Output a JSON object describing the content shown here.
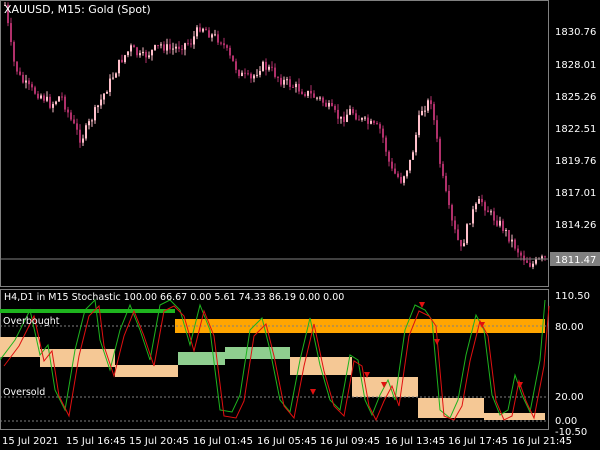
{
  "main_chart": {
    "title": "XAUUSD, M15:  Gold (Spot)",
    "price_ticks": [
      "1830.76",
      "1828.01",
      "1825.26",
      "1822.51",
      "1819.76",
      "1817.01",
      "1814.26"
    ],
    "current_price": "1811.47"
  },
  "indicator": {
    "title": "H4,D1 in M15 Stochastic 100.00 66.67 0.00 5.61 74.33 86.19 0.00 0.00",
    "overbought_label": "Overbought",
    "oversold_label": "Oversold",
    "ticks": [
      "110.50",
      "80.00",
      "20.00",
      "0.00",
      "-10.50"
    ]
  },
  "time_axis": [
    "15 Jul 2021",
    "15 Jul 16:45",
    "15 Jul 20:45",
    "16 Jul 01:45",
    "16 Jul 05:45",
    "16 Jul 09:45",
    "16 Jul 13:45",
    "16 Jul 17:45",
    "16 Jul 21:45"
  ],
  "colors": {
    "bull": "#ffc0cb",
    "bear": "#b0306a",
    "green_line": "#1eb41e",
    "red_line": "#e01010",
    "orange_band": "#ffa500",
    "tan_band": "#f5c895",
    "green_band": "#8fce8f",
    "grid_line": "#808080"
  }
}
